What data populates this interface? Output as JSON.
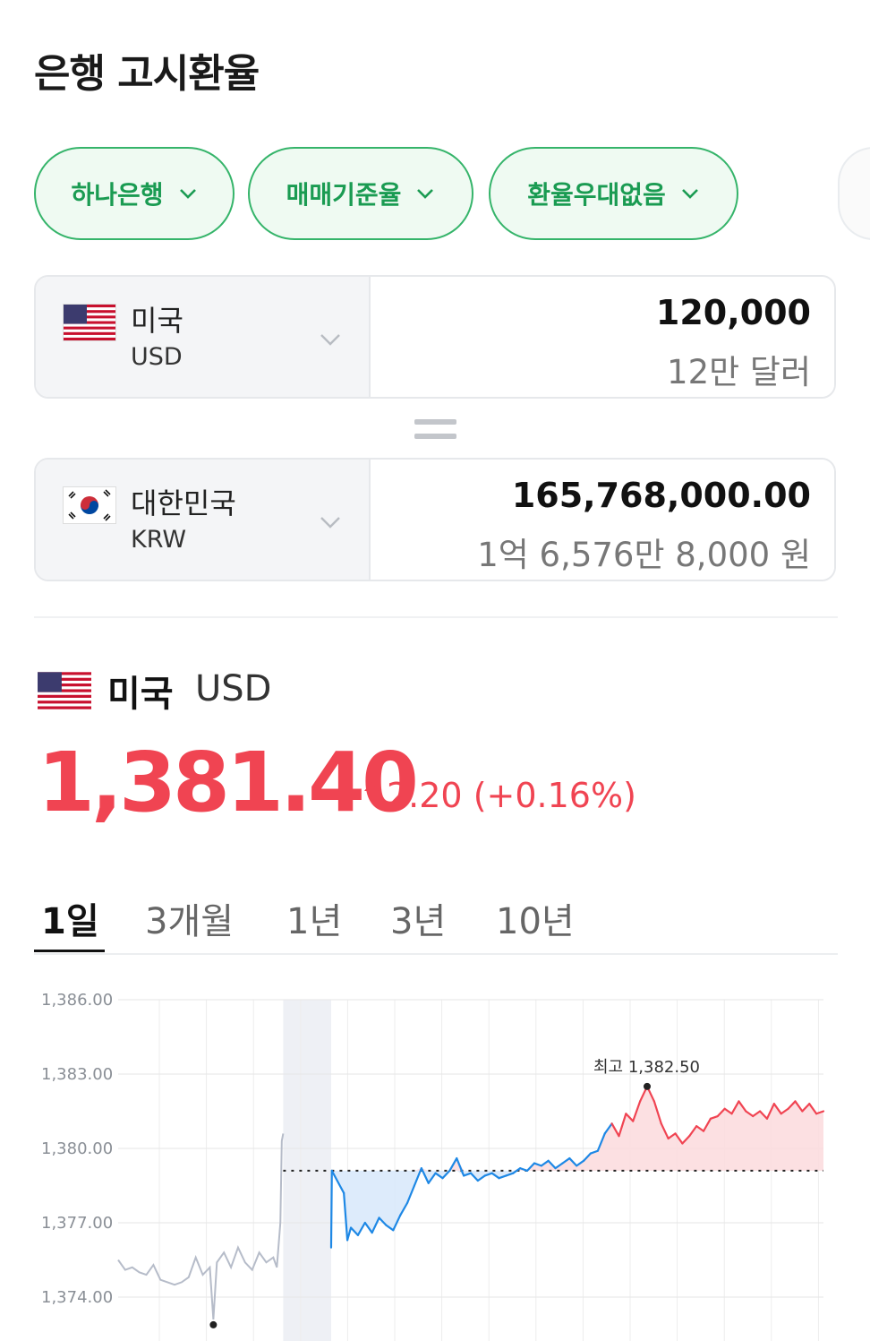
{
  "page": {
    "title": "은행 고시환율"
  },
  "filters": [
    {
      "label": "하나은행"
    },
    {
      "label": "매매기준율"
    },
    {
      "label": "환율우대없음"
    }
  ],
  "from": {
    "country": "미국",
    "code": "USD",
    "amount": "120,000",
    "amount_korean": "12만 달러"
  },
  "to": {
    "country": "대한민국",
    "code": "KRW",
    "amount": "165,768,000.00",
    "amount_korean": "1억 6,576만 8,000 원"
  },
  "summary": {
    "country": "미국",
    "code": "USD",
    "rate": "1,381.40",
    "change": "2.20 (+0.16%)",
    "direction": "up"
  },
  "tabs": [
    "1일",
    "3개월",
    "1년",
    "3년",
    "10년"
  ],
  "active_tab": "1일",
  "colors": {
    "accent_green": "#1a9b52",
    "up_red": "#f04452",
    "down_blue": "#1e88e5",
    "closed_gray": "#b6bcc9"
  },
  "icons": {
    "chip_chevron": "chevron-down-icon",
    "rate_direction": "caret-up-icon"
  },
  "chart_data": {
    "type": "line",
    "ytick_labels": [
      "1,386.00",
      "1,383.00",
      "1,380.00",
      "1,377.00",
      "1,374.00"
    ],
    "ylim": [
      1373.0,
      1386.0
    ],
    "baseline": 1379.1,
    "max_label": "최고 1,382.50",
    "max_value": 1382.5,
    "shaded_band_x": [
      0.234,
      0.302
    ],
    "grid": true,
    "series": [
      {
        "segment": "previous",
        "x": [
          0.0,
          0.01,
          0.02,
          0.03,
          0.04,
          0.05,
          0.06,
          0.07,
          0.08,
          0.09,
          0.1,
          0.11,
          0.12,
          0.13,
          0.135,
          0.14,
          0.15,
          0.16,
          0.17,
          0.18,
          0.19,
          0.2,
          0.21,
          0.22,
          0.225,
          0.23,
          0.232,
          0.234
        ],
        "values": [
          1375.5,
          1375.1,
          1375.2,
          1375.0,
          1374.9,
          1375.3,
          1374.7,
          1374.6,
          1374.5,
          1374.6,
          1374.8,
          1375.6,
          1374.9,
          1375.2,
          1373.1,
          1375.4,
          1375.8,
          1375.2,
          1376.0,
          1375.4,
          1375.1,
          1375.8,
          1375.4,
          1375.6,
          1375.2,
          1377.0,
          1380.3,
          1380.6
        ]
      },
      {
        "segment": "today",
        "x": [
          0.302,
          0.303,
          0.32,
          0.325,
          0.33,
          0.34,
          0.35,
          0.36,
          0.37,
          0.38,
          0.39,
          0.4,
          0.41,
          0.42,
          0.43,
          0.44,
          0.45,
          0.46,
          0.47,
          0.48,
          0.49,
          0.5,
          0.51,
          0.52,
          0.53,
          0.54,
          0.55,
          0.56,
          0.57,
          0.58,
          0.59,
          0.6,
          0.61,
          0.62,
          0.63,
          0.64,
          0.65,
          0.66,
          0.67,
          0.68,
          0.69,
          0.7,
          0.71,
          0.72,
          0.73,
          0.74,
          0.75,
          0.76,
          0.77,
          0.78,
          0.79,
          0.8,
          0.81,
          0.82,
          0.83,
          0.84,
          0.85,
          0.86,
          0.87,
          0.88,
          0.89,
          0.9,
          0.91,
          0.92,
          0.93,
          0.94,
          0.95,
          0.96,
          0.97,
          0.98,
          0.99,
          1.0
        ],
        "values": [
          1376.0,
          1379.1,
          1378.2,
          1376.3,
          1376.8,
          1376.5,
          1377.0,
          1376.6,
          1377.2,
          1376.9,
          1376.7,
          1377.3,
          1377.8,
          1378.5,
          1379.2,
          1378.6,
          1379.0,
          1378.8,
          1379.1,
          1379.6,
          1378.9,
          1379.0,
          1378.7,
          1378.9,
          1379.0,
          1378.8,
          1378.9,
          1379.0,
          1379.2,
          1379.1,
          1379.4,
          1379.3,
          1379.5,
          1379.2,
          1379.4,
          1379.6,
          1379.3,
          1379.5,
          1379.8,
          1379.9,
          1380.6,
          1381.0,
          1380.5,
          1381.4,
          1381.1,
          1381.9,
          1382.5,
          1381.9,
          1381.0,
          1380.4,
          1380.6,
          1380.2,
          1380.5,
          1380.9,
          1380.7,
          1381.2,
          1381.3,
          1381.6,
          1381.4,
          1381.9,
          1381.5,
          1381.3,
          1381.5,
          1381.2,
          1381.8,
          1381.4,
          1381.6,
          1381.9,
          1381.5,
          1381.8,
          1381.4,
          1381.5
        ]
      }
    ]
  }
}
